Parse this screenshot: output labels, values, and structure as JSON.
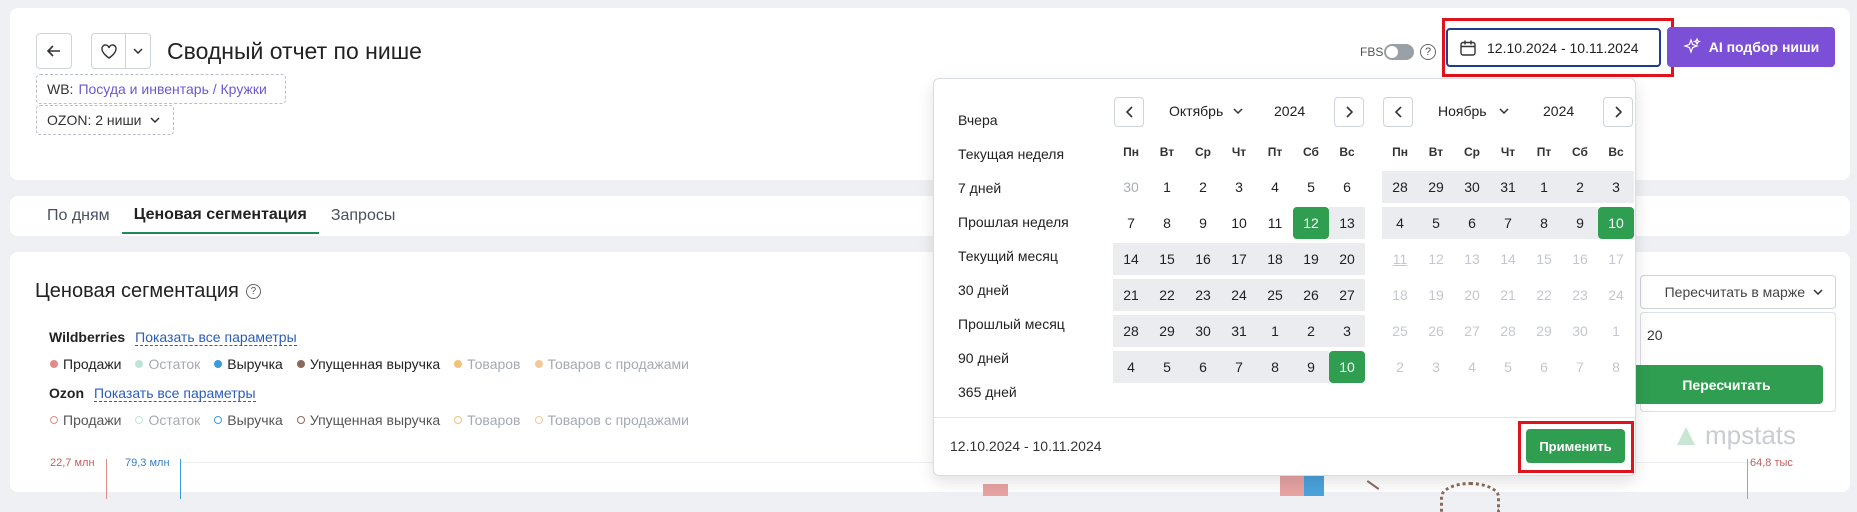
{
  "header": {
    "title": "Сводный отчет по нише",
    "fbs_label": "FBS",
    "date_range": "12.10.2024 - 10.11.2024",
    "ai_button": "AI подбор ниши"
  },
  "filters": {
    "wb_prefix": "WB:",
    "wb_value": "Посуда и инвентарь / Кружки",
    "ozon_label": "OZON: 2 ниши"
  },
  "tabs": [
    {
      "label": "По дням"
    },
    {
      "label": "Ценовая сегментация"
    },
    {
      "label": "Запросы"
    }
  ],
  "section": {
    "title": "Ценовая сегментация",
    "wb_label": "Wildberries",
    "ozon_label": "Ozon",
    "show_all": "Показать все параметры",
    "legend": [
      "Продажи",
      "Остаток",
      "Выручка",
      "Упущенная выручка",
      "Товаров",
      "Товаров с продажами"
    ],
    "legend_colors": [
      "#e08a8a",
      "#9fd6c2",
      "#3a9bd8",
      "#8b6a5a",
      "#f3c07a",
      "#f3c99a"
    ],
    "y_left_1": "22,7 млн",
    "y_left_2": "79,3 млн",
    "y_right": "64,8 тыс"
  },
  "right_panel": {
    "recalc_select": "Пересчитать в марже",
    "input_value": "20",
    "recalc_button": "Пересчитать",
    "brand": "mpstats"
  },
  "calendar": {
    "presets": [
      "Вчера",
      "Текущая неделя",
      "7 дней",
      "Прошлая неделя",
      "Текущий месяц",
      "30 дней",
      "Прошлый месяц",
      "90 дней",
      "365 дней"
    ],
    "weekdays": [
      "Пн",
      "Вт",
      "Ср",
      "Чт",
      "Пт",
      "Сб",
      "Вс"
    ],
    "left": {
      "month": "Октябрь",
      "year": "2024",
      "days": [
        {
          "d": "30",
          "s": "out"
        },
        {
          "d": "1",
          "s": "n"
        },
        {
          "d": "2",
          "s": "n"
        },
        {
          "d": "3",
          "s": "n"
        },
        {
          "d": "4",
          "s": "n"
        },
        {
          "d": "5",
          "s": "n"
        },
        {
          "d": "6",
          "s": "n"
        },
        {
          "d": "7",
          "s": "n"
        },
        {
          "d": "8",
          "s": "n"
        },
        {
          "d": "9",
          "s": "n"
        },
        {
          "d": "10",
          "s": "n"
        },
        {
          "d": "11",
          "s": "n"
        },
        {
          "d": "12",
          "s": "sel"
        },
        {
          "d": "13",
          "s": "in"
        },
        {
          "d": "14",
          "s": "in"
        },
        {
          "d": "15",
          "s": "in"
        },
        {
          "d": "16",
          "s": "in"
        },
        {
          "d": "17",
          "s": "in"
        },
        {
          "d": "18",
          "s": "in"
        },
        {
          "d": "19",
          "s": "in"
        },
        {
          "d": "20",
          "s": "in"
        },
        {
          "d": "21",
          "s": "in"
        },
        {
          "d": "22",
          "s": "in"
        },
        {
          "d": "23",
          "s": "in"
        },
        {
          "d": "24",
          "s": "in"
        },
        {
          "d": "25",
          "s": "in"
        },
        {
          "d": "26",
          "s": "in"
        },
        {
          "d": "27",
          "s": "in"
        },
        {
          "d": "28",
          "s": "in"
        },
        {
          "d": "29",
          "s": "in"
        },
        {
          "d": "30",
          "s": "in"
        },
        {
          "d": "31",
          "s": "in"
        },
        {
          "d": "1",
          "s": "in"
        },
        {
          "d": "2",
          "s": "in"
        },
        {
          "d": "3",
          "s": "in"
        },
        {
          "d": "4",
          "s": "in"
        },
        {
          "d": "5",
          "s": "in"
        },
        {
          "d": "6",
          "s": "in"
        },
        {
          "d": "7",
          "s": "in"
        },
        {
          "d": "8",
          "s": "in"
        },
        {
          "d": "9",
          "s": "in"
        },
        {
          "d": "10",
          "s": "sel"
        }
      ]
    },
    "right": {
      "month": "Ноябрь",
      "year": "2024",
      "days": [
        {
          "d": "28",
          "s": "in"
        },
        {
          "d": "29",
          "s": "in"
        },
        {
          "d": "30",
          "s": "in"
        },
        {
          "d": "31",
          "s": "in"
        },
        {
          "d": "1",
          "s": "in"
        },
        {
          "d": "2",
          "s": "in"
        },
        {
          "d": "3",
          "s": "in"
        },
        {
          "d": "4",
          "s": "in"
        },
        {
          "d": "5",
          "s": "in"
        },
        {
          "d": "6",
          "s": "in"
        },
        {
          "d": "7",
          "s": "in"
        },
        {
          "d": "8",
          "s": "in"
        },
        {
          "d": "9",
          "s": "in"
        },
        {
          "d": "10",
          "s": "sel"
        },
        {
          "d": "11",
          "s": "today"
        },
        {
          "d": "12",
          "s": "dis"
        },
        {
          "d": "13",
          "s": "dis"
        },
        {
          "d": "14",
          "s": "dis"
        },
        {
          "d": "15",
          "s": "dis"
        },
        {
          "d": "16",
          "s": "dis"
        },
        {
          "d": "17",
          "s": "dis"
        },
        {
          "d": "18",
          "s": "dis"
        },
        {
          "d": "19",
          "s": "dis"
        },
        {
          "d": "20",
          "s": "dis"
        },
        {
          "d": "21",
          "s": "dis"
        },
        {
          "d": "22",
          "s": "dis"
        },
        {
          "d": "23",
          "s": "dis"
        },
        {
          "d": "24",
          "s": "dis"
        },
        {
          "d": "25",
          "s": "dis"
        },
        {
          "d": "26",
          "s": "dis"
        },
        {
          "d": "27",
          "s": "dis"
        },
        {
          "d": "28",
          "s": "dis"
        },
        {
          "d": "29",
          "s": "dis"
        },
        {
          "d": "30",
          "s": "dis"
        },
        {
          "d": "1",
          "s": "dis"
        },
        {
          "d": "2",
          "s": "dis"
        },
        {
          "d": "3",
          "s": "dis"
        },
        {
          "d": "4",
          "s": "dis"
        },
        {
          "d": "5",
          "s": "dis"
        },
        {
          "d": "6",
          "s": "dis"
        },
        {
          "d": "7",
          "s": "dis"
        },
        {
          "d": "8",
          "s": "dis"
        }
      ]
    },
    "footer_range": "12.10.2024 - 10.11.2024",
    "apply": "Применить"
  },
  "colors": {
    "accent_green": "#2f9e50",
    "purple": "#7b4fd6",
    "highlight_red": "#e0121b"
  }
}
